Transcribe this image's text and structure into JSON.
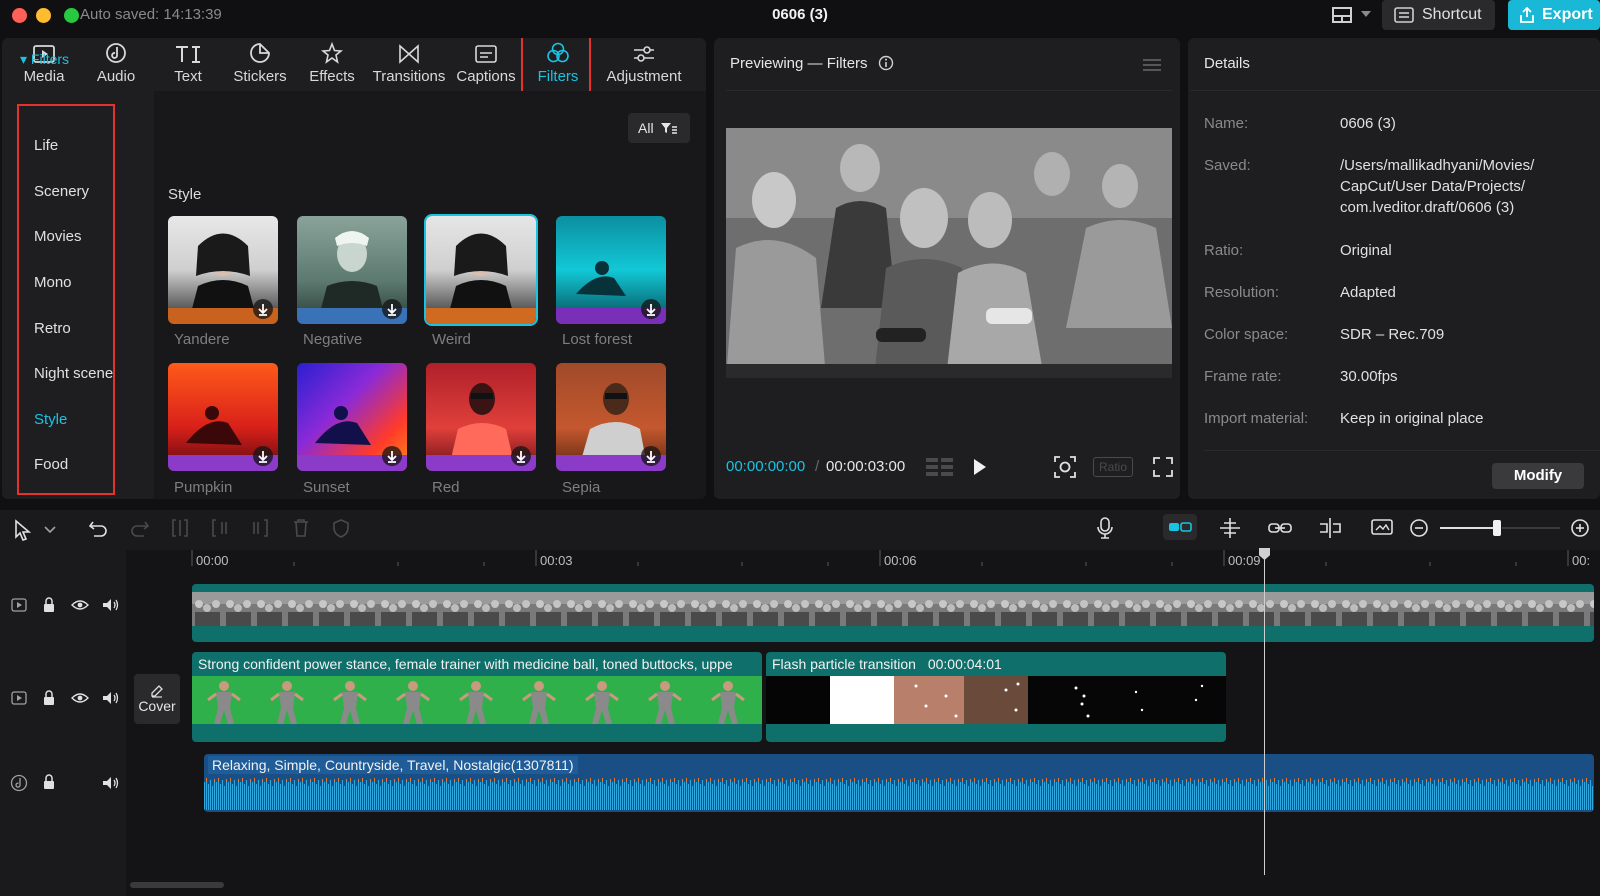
{
  "titlebar": {
    "autosave": "Auto saved: 14:13:39",
    "project_title": "0606 (3)",
    "shortcut_label": "Shortcut",
    "export_label": "Export"
  },
  "toolbar": {
    "items": [
      {
        "label": "Media",
        "icon": "media-icon"
      },
      {
        "label": "Audio",
        "icon": "audio-icon"
      },
      {
        "label": "Text",
        "icon": "text-icon"
      },
      {
        "label": "Stickers",
        "icon": "stickers-icon"
      },
      {
        "label": "Effects",
        "icon": "effects-icon"
      },
      {
        "label": "Transitions",
        "icon": "transitions-icon"
      },
      {
        "label": "Captions",
        "icon": "captions-icon"
      },
      {
        "label": "Filters",
        "icon": "filters-icon",
        "active": true
      },
      {
        "label": "Adjustment",
        "icon": "adjustment-icon"
      }
    ]
  },
  "categories": {
    "header": "Filters",
    "items": [
      "Life",
      "Scenery",
      "Movies",
      "Mono",
      "Retro",
      "Night scene",
      "Style",
      "Food"
    ],
    "active": "Style"
  },
  "grid": {
    "all_label": "All",
    "section_label": "Style",
    "filters": [
      {
        "name": "Yandere",
        "bar_color": "#c8621e"
      },
      {
        "name": "Negative",
        "bar_color": "#3a72b8"
      },
      {
        "name": "Weird",
        "bar_color": "#d06a20",
        "selected": true
      },
      {
        "name": "Lost forest",
        "bar_color": "#7a2fb8"
      },
      {
        "name": "Pumpkin",
        "bar_color": "#8a3bc8"
      },
      {
        "name": "Sunset",
        "bar_color": "#8a3bc8"
      },
      {
        "name": "Red",
        "bar_color": "#8a3bc8"
      },
      {
        "name": "Sepia",
        "bar_color": "#8a3bc8"
      }
    ]
  },
  "preview": {
    "title": "Previewing — Filters",
    "current_time": "00:00:00:00",
    "total_time": "00:00:03:00",
    "ratio_label": "Ratio"
  },
  "details": {
    "title": "Details",
    "fields": [
      {
        "key": "Name:",
        "value": "0606 (3)"
      },
      {
        "key": "Saved:",
        "value": "/Users/mallikadhyani/Movies/\nCapCut/User Data/Projects/\ncom.lveditor.draft/0606 (3)"
      },
      {
        "key": "Ratio:",
        "value": "Original"
      },
      {
        "key": "Resolution:",
        "value": "Adapted"
      },
      {
        "key": "Color space:",
        "value": "SDR – Rec.709"
      },
      {
        "key": "Frame rate:",
        "value": "30.00fps"
      },
      {
        "key": "Import material:",
        "value": "Keep in original place"
      }
    ],
    "modify_label": "Modify"
  },
  "timeline": {
    "ruler": [
      "00:00",
      "00:03",
      "00:06",
      "00:09",
      "00:"
    ],
    "cover_label": "Cover",
    "clips": {
      "main_label": "",
      "overlay_label": "Strong confident power stance, female trainer with medicine ball, toned buttocks, uppe",
      "transition_label": "Flash particle transition",
      "transition_time": "00:00:04:01",
      "audio_label": "Relaxing, Simple, Countryside, Travel, Nostalgic(1307811)"
    }
  },
  "colors": {
    "accent": "#19c3e3",
    "highlight_box": "#e5322d",
    "clip_teal": "#0f6f6a",
    "audio_blue": "#1a4f86"
  }
}
